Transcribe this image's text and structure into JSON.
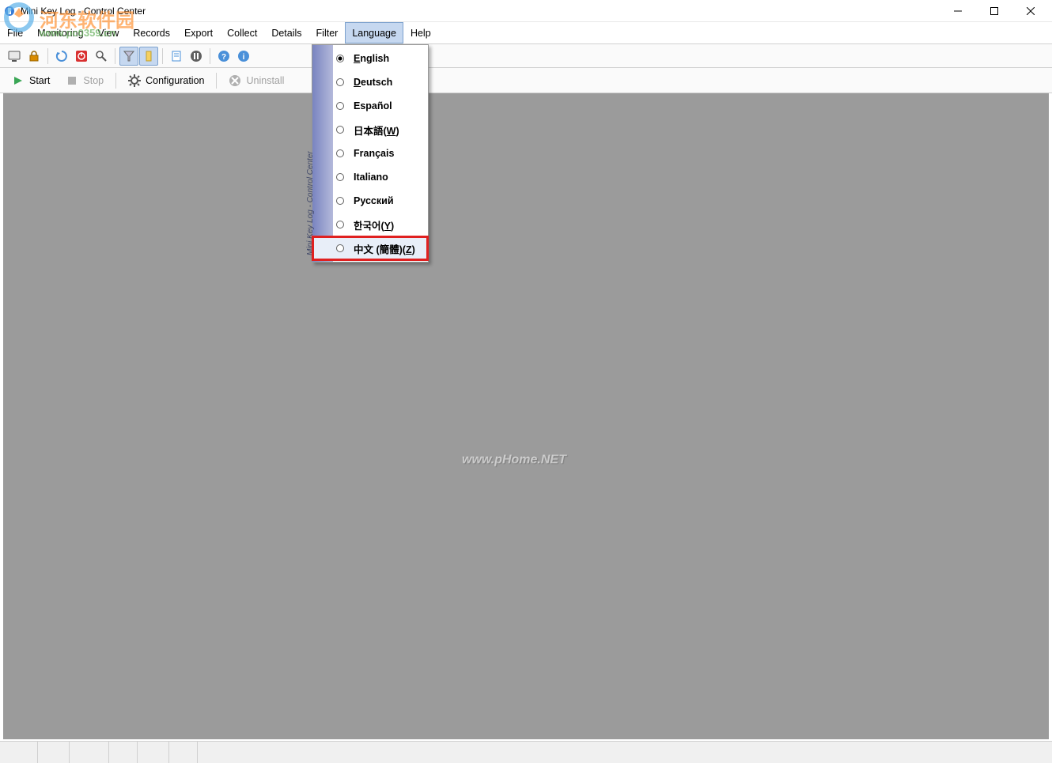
{
  "window": {
    "title": "Mini Key Log - Control Center"
  },
  "menu": {
    "file": "File",
    "monitoring": "Monitoring",
    "view": "View",
    "records": "Records",
    "export": "Export",
    "collect": "Collect",
    "details": "Details",
    "filter": "Filter",
    "language": "Language",
    "help": "Help"
  },
  "toolbar2": {
    "start": "Start",
    "stop": "Stop",
    "configuration": "Configuration",
    "uninstall": "Uninstall"
  },
  "language_menu": {
    "sidebar_text": "Mini Key Log - Control Center",
    "items": [
      {
        "label": "English",
        "underline": "E",
        "rest": "nglish",
        "suffix": "",
        "selected": true,
        "highlighted": false
      },
      {
        "label": "Deutsch",
        "underline": "D",
        "rest": "eutsch",
        "suffix": "",
        "selected": false,
        "highlighted": false
      },
      {
        "label": "Español",
        "underline": "",
        "rest": "Español",
        "suffix": "",
        "selected": false,
        "highlighted": false
      },
      {
        "label": "日本語(W)",
        "underline": "",
        "rest": "日本語(",
        "suffix": "W)",
        "selected": false,
        "highlighted": false
      },
      {
        "label": "Français",
        "underline": "",
        "rest": "Français",
        "suffix": "",
        "selected": false,
        "highlighted": false
      },
      {
        "label": "Italiano",
        "underline": "",
        "rest": "Italiano",
        "suffix": "",
        "selected": false,
        "highlighted": false
      },
      {
        "label": "Русский",
        "underline": "",
        "rest": "Русский",
        "suffix": "",
        "selected": false,
        "highlighted": false
      },
      {
        "label": "한국어(Y)",
        "underline": "",
        "rest": "한국어(",
        "suffix": "Y)",
        "selected": false,
        "highlighted": false
      },
      {
        "label": "中文 (簡體)(Z)",
        "underline": "",
        "rest": "中文 (簡體)(",
        "suffix": "Z)",
        "selected": false,
        "highlighted": true
      }
    ]
  },
  "watermarks": {
    "wm1_main": "河东软件园",
    "wm1_sub": "www.pc0359.cn",
    "wm2": "www.pHome.NET"
  }
}
